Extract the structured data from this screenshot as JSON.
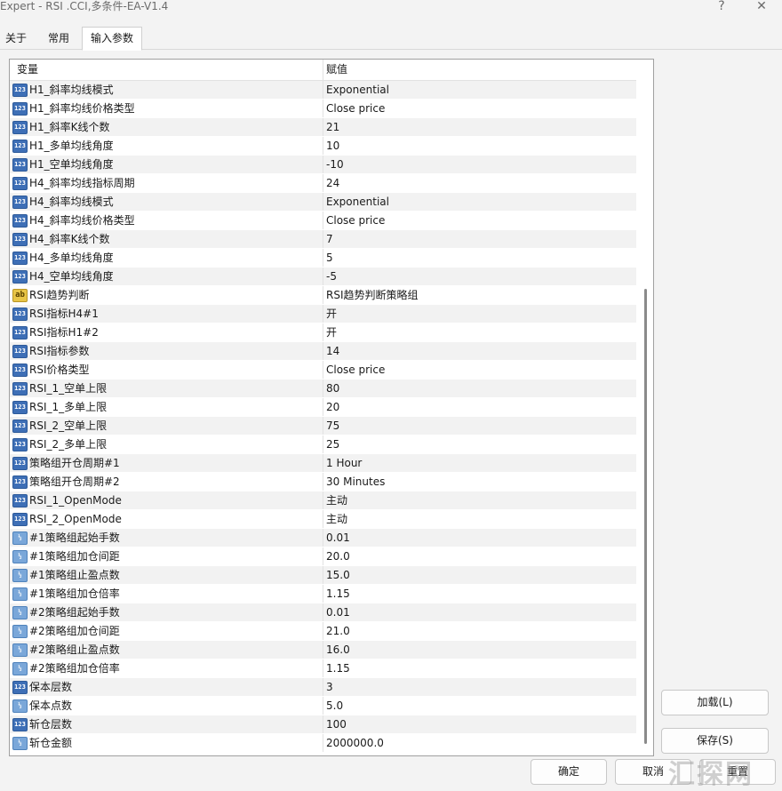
{
  "window": {
    "title": "Expert - RSI .CCI,多条件-EA-V1.4",
    "help_glyph": "?",
    "close_glyph": "✕"
  },
  "tabs": [
    {
      "label": "关于"
    },
    {
      "label": "常用"
    },
    {
      "label": "输入参数"
    }
  ],
  "table": {
    "col_variable": "变量",
    "col_value": "赋值",
    "rows": [
      {
        "icon": "123",
        "name": "H1_斜率均线模式",
        "value": "Exponential"
      },
      {
        "icon": "123",
        "name": "H1_斜率均线价格类型",
        "value": "Close price"
      },
      {
        "icon": "123",
        "name": "H1_斜率K线个数",
        "value": "21"
      },
      {
        "icon": "123",
        "name": "H1_多单均线角度",
        "value": "10"
      },
      {
        "icon": "123",
        "name": "H1_空单均线角度",
        "value": "-10"
      },
      {
        "icon": "123",
        "name": "H4_斜率均线指标周期",
        "value": "24"
      },
      {
        "icon": "123",
        "name": "H4_斜率均线模式",
        "value": "Exponential"
      },
      {
        "icon": "123",
        "name": "H4_斜率均线价格类型",
        "value": "Close price"
      },
      {
        "icon": "123",
        "name": "H4_斜率K线个数",
        "value": "7"
      },
      {
        "icon": "123",
        "name": "H4_多单均线角度",
        "value": "5"
      },
      {
        "icon": "123",
        "name": "H4_空单均线角度",
        "value": "-5"
      },
      {
        "icon": "ab",
        "name": "RSI趋势判断",
        "value": "RSI趋势判断策略组"
      },
      {
        "icon": "123",
        "name": "RSI指标H4#1",
        "value": "开"
      },
      {
        "icon": "123",
        "name": "RSI指标H1#2",
        "value": "开"
      },
      {
        "icon": "123",
        "name": "RSI指标参数",
        "value": "14"
      },
      {
        "icon": "123",
        "name": "RSI价格类型",
        "value": "Close price"
      },
      {
        "icon": "123",
        "name": "RSI_1_空单上限",
        "value": "80"
      },
      {
        "icon": "123",
        "name": "RSI_1_多单上限",
        "value": "20"
      },
      {
        "icon": "123",
        "name": "RSI_2_空单上限",
        "value": "75"
      },
      {
        "icon": "123",
        "name": "RSI_2_多单上限",
        "value": "25"
      },
      {
        "icon": "123",
        "name": "策略组开仓周期#1",
        "value": "1 Hour"
      },
      {
        "icon": "123",
        "name": "策略组开仓周期#2",
        "value": "30 Minutes"
      },
      {
        "icon": "123",
        "name": "RSI_1_OpenMode",
        "value": "主动"
      },
      {
        "icon": "123",
        "name": "RSI_2_OpenMode",
        "value": "主动"
      },
      {
        "icon": "frac",
        "name": "#1策略组起始手数",
        "value": "0.01"
      },
      {
        "icon": "frac",
        "name": "#1策略组加仓间距",
        "value": "20.0"
      },
      {
        "icon": "frac",
        "name": "#1策略组止盈点数",
        "value": "15.0"
      },
      {
        "icon": "frac",
        "name": "#1策略组加仓倍率",
        "value": "1.15"
      },
      {
        "icon": "frac",
        "name": "#2策略组起始手数",
        "value": "0.01"
      },
      {
        "icon": "frac",
        "name": "#2策略组加仓间距",
        "value": "21.0"
      },
      {
        "icon": "frac",
        "name": "#2策略组止盈点数",
        "value": "16.0"
      },
      {
        "icon": "frac",
        "name": "#2策略组加仓倍率",
        "value": "1.15"
      },
      {
        "icon": "123",
        "name": "保本层数",
        "value": "3"
      },
      {
        "icon": "frac",
        "name": "保本点数",
        "value": "5.0"
      },
      {
        "icon": "123",
        "name": "斩仓层数",
        "value": "100"
      },
      {
        "icon": "frac",
        "name": "斩仓金额",
        "value": "2000000.0"
      }
    ]
  },
  "icon_glyphs": {
    "123": "123",
    "ab": "ab",
    "frac": "½"
  },
  "buttons": {
    "load": "加载(L)",
    "save": "保存(S)",
    "ok": "确定",
    "cancel": "取消",
    "reset": "重置"
  },
  "watermark": "汇探网"
}
